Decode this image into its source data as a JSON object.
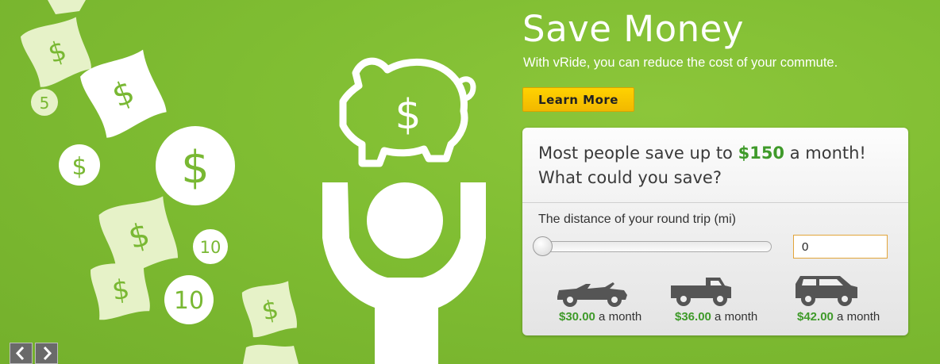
{
  "hero": {
    "title": "Save Money",
    "subtitle": "With vRide, you can reduce the cost of your commute.",
    "cta_label": "Learn More"
  },
  "calculator": {
    "headline_pre": "Most people save up to ",
    "headline_amount": "$150",
    "headline_post": " a month!",
    "headline_line2": "What could you save?",
    "distance_label": "The distance of your round trip (mi)",
    "distance_value": "0",
    "slider_value": 0,
    "vehicles": [
      {
        "icon": "convertible-car-icon",
        "amount": "$30.00",
        "suffix": " a month"
      },
      {
        "icon": "pickup-truck-icon",
        "amount": "$36.00",
        "suffix": " a month"
      },
      {
        "icon": "suv-icon",
        "amount": "$42.00",
        "suffix": " a month"
      }
    ]
  },
  "illustration": {
    "symbol": "$",
    "coin_values": [
      "5",
      "10",
      "10"
    ]
  },
  "carousel": {
    "prev_icon": "chevron-left-icon",
    "next_icon": "chevron-right-icon"
  },
  "colors": {
    "background": "#7fbd32",
    "accent_green": "#3f9a2a",
    "button_yellow": "#f9c800",
    "bill_tint": "#e6f2c8"
  }
}
